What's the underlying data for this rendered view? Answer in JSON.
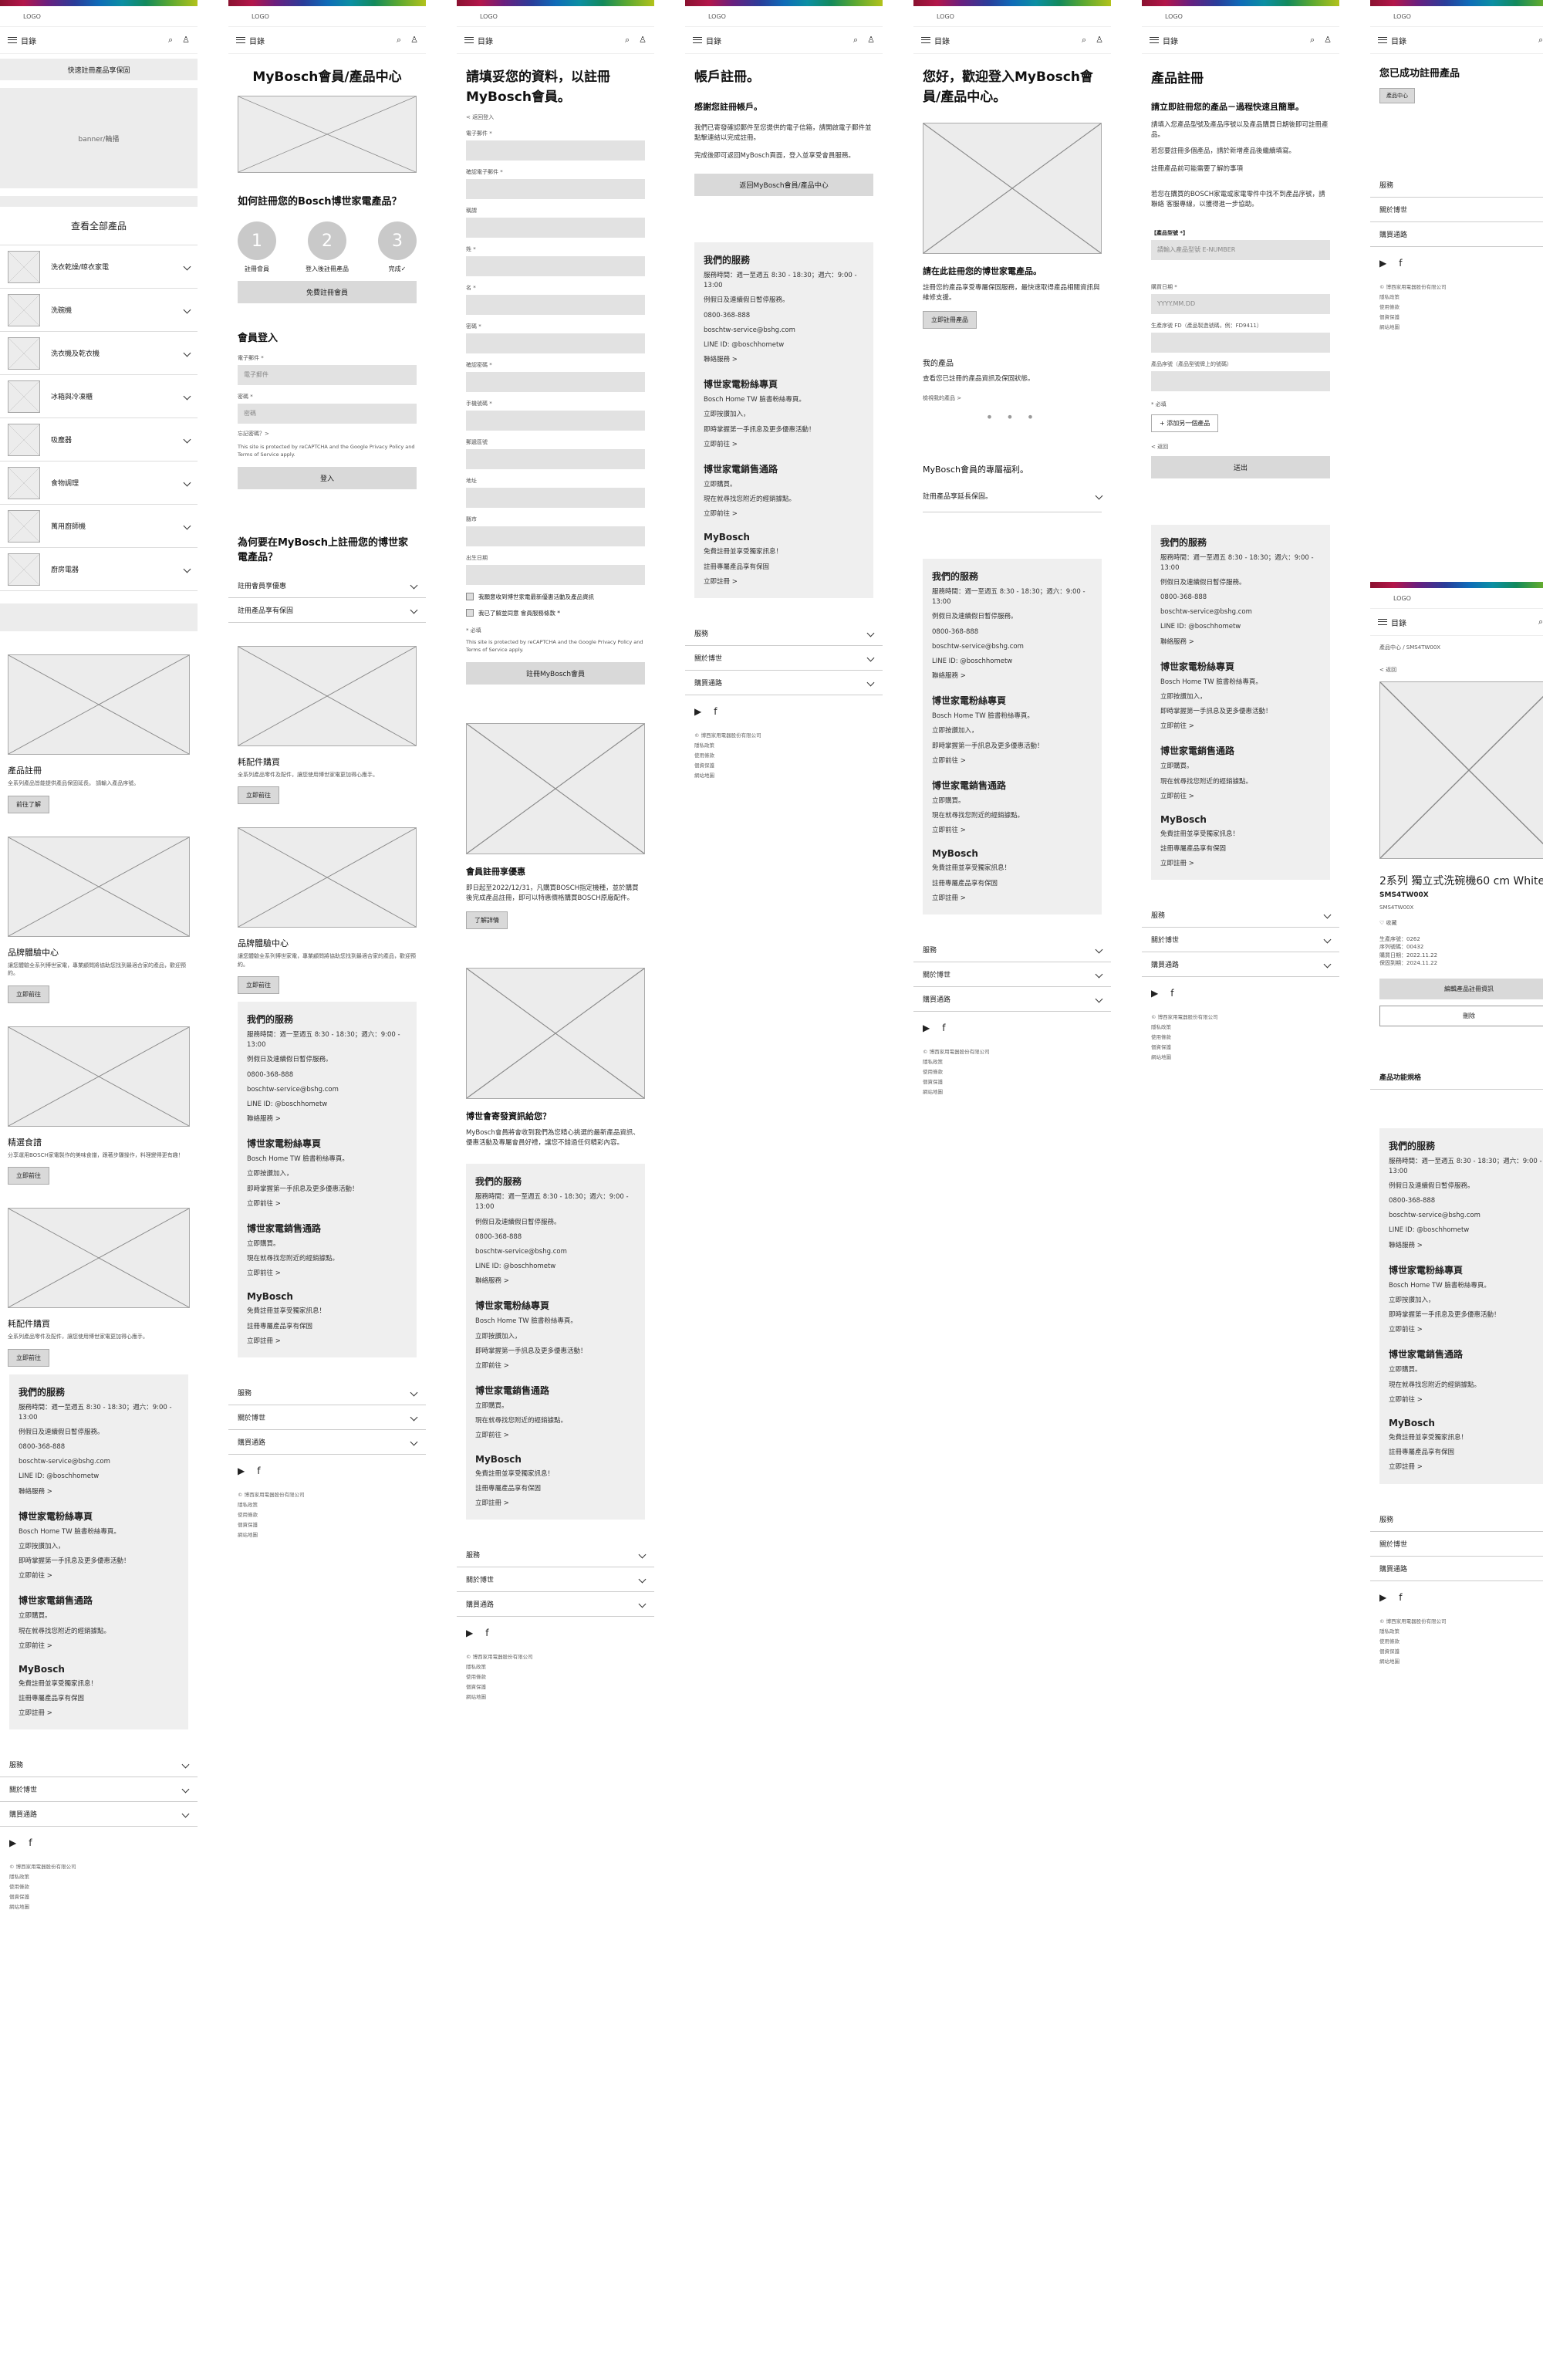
{
  "common": {
    "logo": "LOGO",
    "menu": "目錄",
    "search_icon": "search-icon",
    "user_icon": "user-icon",
    "footer_acc": [
      "服務",
      "關於博世",
      "購買通路"
    ],
    "social": [
      "youtube-icon",
      "facebook-icon"
    ],
    "copyright_lines": [
      "© 博西家用電器股份有限公司",
      "隱私政策",
      "使用條款",
      "個資保護",
      "網站地圖"
    ],
    "services": [
      {
        "title": "我們的服務",
        "lines": [
          "服務時間：週一至週五 8:30 - 18:30；週六：9:00 - 13:00",
          "例假日及連續假日暫停服務。",
          "0800-368-888",
          "boschtw-service@bshg.com",
          "LINE ID: @boschhometw",
          "聯絡服務 >"
        ]
      },
      {
        "title": "博世家電粉絲專頁",
        "lines": [
          "Bosch Home TW 臉書粉絲專頁。",
          "立即按讚加入，",
          "即時掌握第一手訊息及更多優惠活動！",
          "立即前往 >"
        ]
      },
      {
        "title": "博世家電銷售通路",
        "lines": [
          "立即購買。",
          "現在就尋找您附近的經銷據點。",
          "立即前往 >"
        ]
      },
      {
        "title": "MyBosch",
        "lines": [
          "免費註冊並享受獨家訊息！",
          "註冊專屬產品享有保固",
          "立即註冊 >"
        ]
      }
    ]
  },
  "s1": {
    "promo_bar": "快速註冊產品享保固",
    "banner": "banner/輪播",
    "all_products": "查看全部產品",
    "categories": [
      "洗衣乾燥/晾衣家電",
      "洗碗機",
      "洗衣機及乾衣機",
      "冰箱與冷凍櫃",
      "吸塵器",
      "食物調理",
      "萬用廚師機",
      "廚房電器"
    ],
    "features": [
      {
        "title": "產品註冊",
        "text": "全系列產品皆能提供產品保固延長。\n請輸入產品序號。",
        "btn": "前往了解"
      },
      {
        "title": "品牌體驗中心",
        "text": "讓您體驗全系列博世家電，專業顧問將協助您找到最適合家的產品，歡迎預約。",
        "btn": "立即前往"
      },
      {
        "title": "精選食譜",
        "text": "分享運用BOSCH家電製作的美味食譜，跟著步驟操作，料理變得更有趣！",
        "btn": "立即前往"
      },
      {
        "title": "耗配件購買",
        "text": "全系列產品零件及配件，讓您使用博世家電更加得心應手。",
        "btn": "立即前往"
      }
    ]
  },
  "s2": {
    "title": "MyBosch會員/產品中心",
    "how_to": "如何註冊您的Bosch博世家電產品？",
    "steps": [
      {
        "n": "1",
        "label": "註冊會員"
      },
      {
        "n": "2",
        "label": "登入後註冊產品"
      },
      {
        "n": "3",
        "label": "完成✓"
      }
    ],
    "register_btn": "免費註冊會員",
    "login_title": "會員登入",
    "email_label": "電子郵件 *",
    "email_ph": "電子郵件",
    "pw_label": "密碼 *",
    "pw_ph": "密碼",
    "forgot": "忘記密碼？>",
    "recaptcha": "This site is protected by reCAPTCHA and the Google Privacy Policy and Terms of Service apply.",
    "login_btn": "登入",
    "why_title": "為何要在MyBosch上註冊您的博世家電產品？",
    "why_items": [
      "註冊會員享優惠",
      "註冊產品享有保固"
    ],
    "features": [
      {
        "title": "耗配件購買",
        "text": "全系列產品零件及配件，讓您使用博世家電更加得心應手。",
        "btn": "立即前往"
      },
      {
        "title": "品牌體驗中心",
        "text": "讓您體驗全系列博世家電，專業顧問將協助您找到最適合家的產品，歡迎預約。",
        "btn": "立即前往"
      }
    ]
  },
  "s3": {
    "title": "請填妥您的資料，以註冊MyBosch會員。",
    "back": "< 返回登入",
    "fields": [
      "電子郵件 *",
      "確認電子郵件 *",
      "稱謂",
      "姓 *",
      "名 *",
      "密碼 *",
      "確認密碼 *",
      "手機號碼 *",
      "郵遞區號",
      "地址",
      "縣市",
      "出生日期"
    ],
    "checks": [
      "我願意收到博世家電最新優惠活動及產品資訊",
      "我已了解並同意 會員服務條款 *"
    ],
    "required": "* 必填",
    "recaptcha": "This site is protected by reCAPTCHA and the Google Privacy Policy and Terms of Service apply.",
    "submit": "註冊MyBosch會員",
    "promo_title": "會員註冊享優惠",
    "promo_text": "即日起至2022/12/31，凡購買BOSCH指定機種，並於購買後完成產品註冊，即可以特惠價格購買BOSCH原廠配件。",
    "promo_btn": "了解詳情",
    "info_title": "博世會寄發資訊給您？",
    "info_text": "MyBosch會員將會收到我們為您精心挑選的最新產品資訊、優惠活動及專屬會員好禮，讓您不錯過任何精彩內容。"
  },
  "s4": {
    "title": "帳戶註冊。",
    "sub": "感謝您註冊帳戶。",
    "text": "我們已寄發確認郵件至您提供的電子信箱，請開啟電子郵件並點擊連結以完成註冊。",
    "text2": "完成後即可返回MyBosch頁面，登入並享受會員服務。",
    "btn": "返回MyBosch會員/產品中心"
  },
  "s5": {
    "title": "您好，歡迎登入MyBosch會員/產品中心。",
    "reg_title": "請在此註冊您的博世家電產品。",
    "reg_text": "註冊您的產品享受專屬保固服務，最快速取得產品相關資訊與維修支援。",
    "reg_btn": "立即註冊產品",
    "my_products": "我的產品",
    "my_products_text": "查看您已註冊的產品資訊及保固狀態。",
    "see_all": "檢視我的產品 >",
    "benefit_title": "MyBosch會員的專屬福利。",
    "benefit_item": "註冊產品享延長保固。"
  },
  "s6": {
    "title": "產品註冊",
    "sub": "請立即註冊您的產品－過程快速且簡單。",
    "text": "請填入您產品型號及產品序號以及產品購買日期後即可註冊產品。",
    "text2": "若您要註冊多個產品，請於新增產品後繼續填寫。",
    "link": "註冊產品前可能需要了解的事項",
    "note": "若您在購買的BOSCH家電或家電零件中找不到產品序號，請聯絡 客服專線，以獲得進一步協助。",
    "serial_label": "【產品型號 *】",
    "serial_ph": "請輸入產品型號 E-NUMBER",
    "date_label": "購買日期 *",
    "date_ph": "YYYY.MM.DD",
    "fd_label": "生產序號 FD（產品製造號碼，例：FD9411）",
    "zno_label": "產品序號（產品型號牌上的號碼）",
    "required": "* 必填",
    "add_btn": "+ 添加另一個產品",
    "back": "< 返回",
    "submit": "送出"
  },
  "s7": {
    "title": "您已成功註冊產品",
    "badge": "產品中心",
    "acc": [
      "服務",
      "關於博世",
      "購買通路"
    ]
  },
  "s8": {
    "breadcrumb": "產品中心 / SMS4TW00X",
    "back": "< 返回",
    "product_name": "2系列 獨立式洗碗機60 cm White",
    "model": "SMS4TW00X",
    "model_small": "SMS4TW00X",
    "collect": "♡ 收藏",
    "details": [
      "生產序號：0262",
      "序列號碼：00432",
      "購買日期：2022.11.22",
      "保固到期：2024.11.22"
    ],
    "edit_btn": "編輯產品註冊資訊",
    "delete_btn": "刪除",
    "spec": "產品功能規格"
  }
}
